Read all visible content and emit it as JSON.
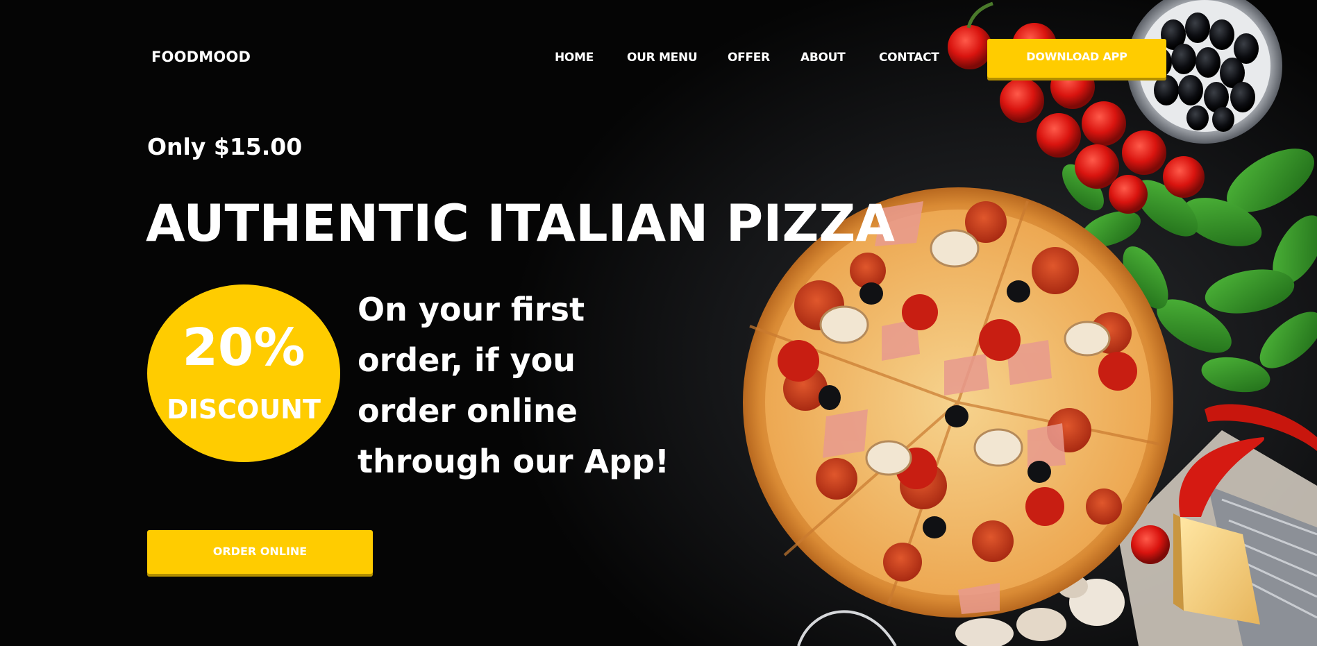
{
  "header": {
    "logo": "FOODMOOD",
    "nav": [
      "HOME",
      "OUR MENU",
      "OFFER",
      "ABOUT",
      "CONTACT"
    ],
    "download_label": "DOWNLOAD APP"
  },
  "hero": {
    "price": "Only $15.00",
    "headline": "AUTHENTIC ITALIAN PIZZA",
    "badge_percent": "20%",
    "badge_text": "DISCOUNT",
    "offer_lines": [
      "On your first",
      "order, if you",
      "order online",
      "through our App!"
    ],
    "order_label": "ORDER ONLINE"
  },
  "colors": {
    "accent": "#ffcc00",
    "background": "#050505",
    "text": "#ffffff"
  },
  "images": {
    "hero": "pizza-with-ingredients-photo"
  }
}
